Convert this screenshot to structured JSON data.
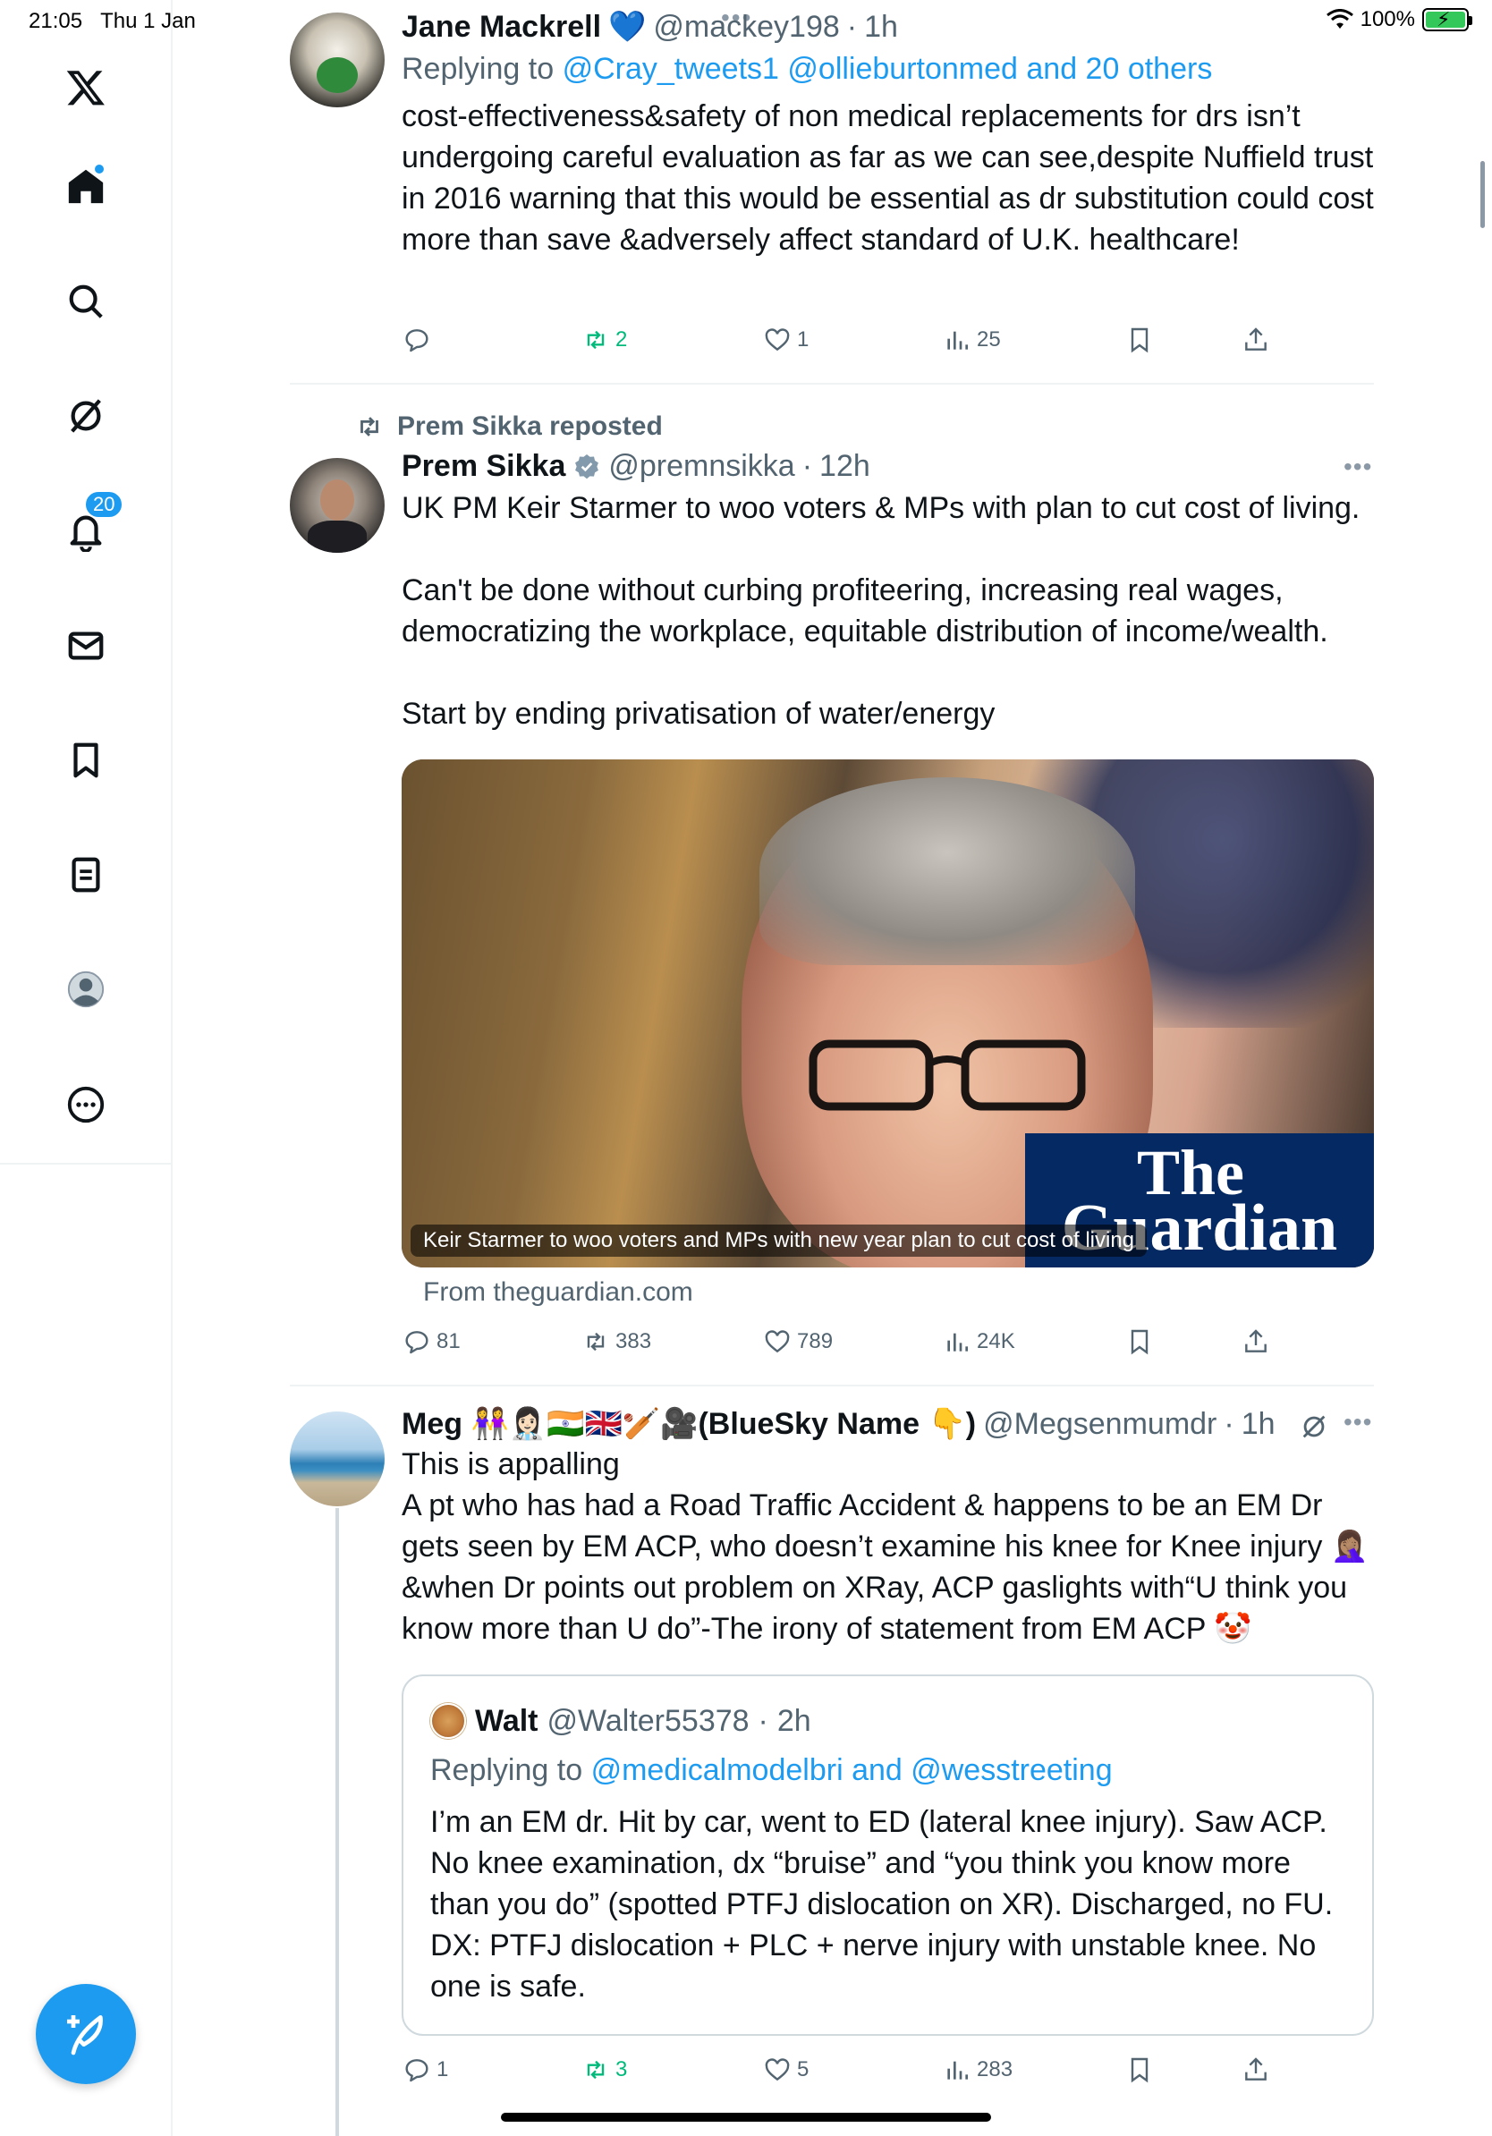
{
  "status": {
    "time": "21:05",
    "date": "Thu 1 Jan",
    "battery": "100%"
  },
  "nav": {
    "items": [
      {
        "name": "x-logo"
      },
      {
        "name": "home"
      },
      {
        "name": "search"
      },
      {
        "name": "grok"
      },
      {
        "name": "notifications",
        "badge": "20"
      },
      {
        "name": "messages"
      },
      {
        "name": "bookmarks"
      },
      {
        "name": "lists"
      },
      {
        "name": "profile"
      },
      {
        "name": "more"
      }
    ]
  },
  "tweets": [
    {
      "name": "Jane Mackrell",
      "emoji": "💙",
      "handle": "@mackey198",
      "sep": "·",
      "time": "1h",
      "reply_prefix": "Replying to",
      "reply_links": "@Cray_tweets1 @ollieburtonmed and 20 others",
      "body": "cost-effectiveness&safety of non medical replacements for drs isn’t undergoing careful evaluation as far as we can see,despite Nuffield trust in 2016 warning that this would be essential as dr substitution could cost more than save &adversely affect standard of U.K. healthcare!",
      "replies": "",
      "reposts": "2",
      "likes": "1",
      "views": "25"
    },
    {
      "repost_label": "Prem Sikka reposted",
      "name": "Prem Sikka",
      "handle": "@premnsikka",
      "sep": "·",
      "time": "12h",
      "body": "UK PM Keir Starmer to woo voters & MPs with plan to cut cost of living.\n\nCan't be done without curbing profiteering, increasing real wages, democratizing the workplace, equitable distribution of income/wealth.\n\nStart by ending privatisation of water/energy",
      "card_caption": "Keir Starmer to woo voters and MPs with new year plan to cut cost of living",
      "card_logo_line1": "The",
      "card_logo_line2": "Guardian",
      "card_source": "From theguardian.com",
      "replies": "81",
      "reposts": "383",
      "likes": "789",
      "views": "24K"
    },
    {
      "name": "Meg 👭👩🏻‍⚕️🇮🇳🇬🇧🏏🎥(BlueSky Name 👇)",
      "handle": "@Megsenmumdr",
      "sep": "·",
      "time": "1h",
      "body": "This is appalling\nA pt who has had a Road Traffic Accident & happens to be an EM Dr gets seen by EM ACP, who doesn’t examine his knee for Knee injury 🤦🏽‍♀️ &when Dr points out problem on XRay, ACP gaslights with“U think you know more than U do”-The irony of statement from EM ACP 🤡",
      "quote": {
        "name": "Walt",
        "handle": "@Walter55378",
        "sep": "·",
        "time": "2h",
        "reply_prefix": "Replying to",
        "reply_links": "@medicalmodelbri and @wesstreeting",
        "body": "I’m an EM dr. Hit by car, went to ED (lateral knee injury). Saw ACP. No knee examination, dx  “bruise” and “you think you know more than you do” (spotted PTFJ dislocation on XR). Discharged, no FU. DX: PTFJ dislocation + PLC + nerve injury with unstable knee. No one is safe."
      },
      "replies": "1",
      "reposts": "3",
      "likes": "5",
      "views": "283"
    }
  ],
  "colors": {
    "accent": "#1d9bf0",
    "repost_green": "#00ba7c",
    "muted": "#536471",
    "guardian_blue": "#052962"
  }
}
